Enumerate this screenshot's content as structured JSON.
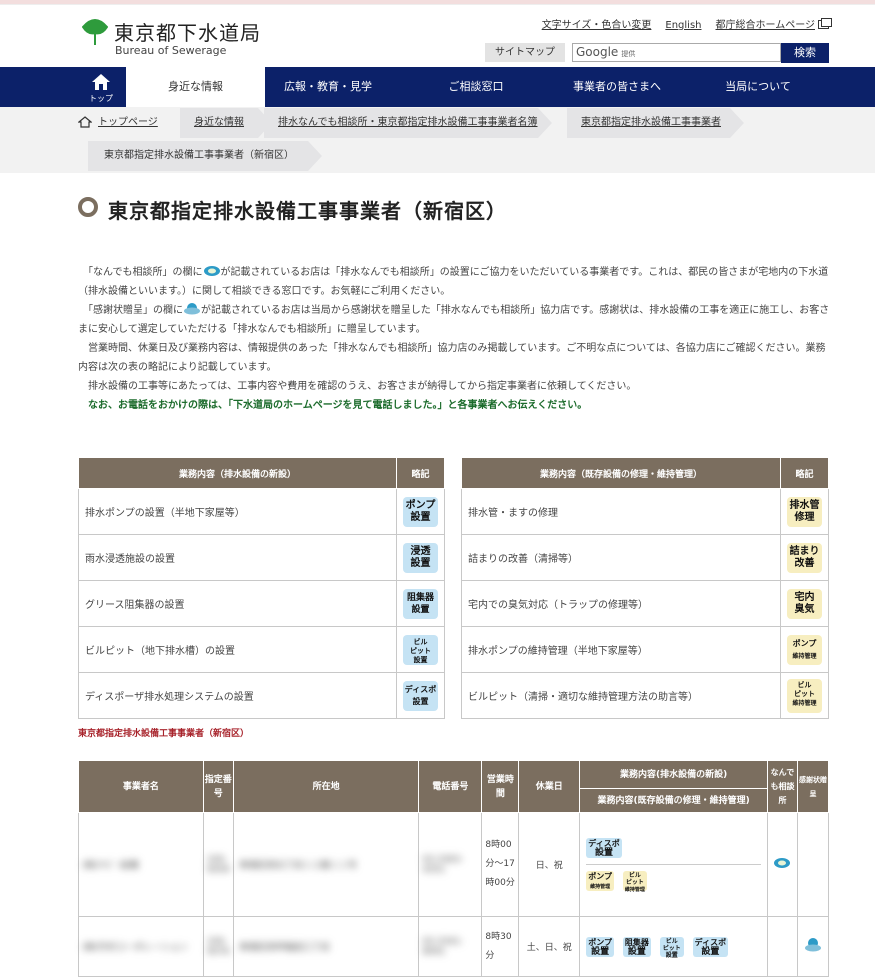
{
  "header": {
    "logo_title": "東京都下水道局",
    "logo_subtitle": "Bureau of Sewerage",
    "links": [
      "文字サイズ・色合い変更",
      "English",
      "都庁総合ホームページ"
    ],
    "sitemap": "サイトマップ",
    "search_google": "Google",
    "search_provided": "提供",
    "search_button": "検索"
  },
  "nav": {
    "home": "トップ",
    "items": [
      "身近な情報",
      "広報・教育・見学",
      "ご相談窓口",
      "事業者の皆さまへ",
      "当局について"
    ]
  },
  "breadcrumb": [
    "トップページ",
    "身近な情報",
    "排水なんでも相談所・東京都指定排水設備工事事業者名簿",
    "東京都指定排水設備工事事業者",
    "東京都指定排水設備工事事業者（新宿区）"
  ],
  "page_title": "東京都指定排水設備工事事業者（新宿区）",
  "intro": {
    "p1a": "「なんでも相談所」の欄に",
    "p1b": "が記載されているお店は「排水なんでも相談所」の設置にご協力をいただいている事業者です。これは、都民の皆さまが宅地内の下水道（排水設備といいます。）に関して相談できる窓口です。お気軽にご利用ください。",
    "p2a": "「感謝状贈呈」の欄に",
    "p2b": "が記載されているお店は当局から感謝状を贈呈した「排水なんでも相談所」協力店です。感謝状は、排水設備の工事を適正に施工し、お客さまに安心して選定していただける「排水なんでも相談所」に贈呈しています。",
    "p3": "営業時間、休業日及び業務内容は、情報提供のあった「排水なんでも相談所」協力店のみ掲載しています。ご不明な点については、各協力店にご確認ください。業務内容は次の表の略記により記載しています。",
    "p4": "排水設備の工事等にあたっては、工事内容や費用を確認のうえ、お客さまが納得してから指定事業者に依頼してください。",
    "note": "なお、お電話をおかけの際は、「下水道局のホームページを見て電話しました。」と各事業者へお伝えください。"
  },
  "new_table": {
    "h1": "業務内容（排水設備の新設）",
    "h2": "略記",
    "rows": [
      {
        "text": "排水ポンプの設置（半地下家屋等）",
        "badge": [
          "ポンプ",
          "設置"
        ]
      },
      {
        "text": "雨水浸透施設の設置",
        "badge": [
          "浸透",
          "設置"
        ]
      },
      {
        "text": "グリース阻集器の設置",
        "badge": [
          "阻集器",
          "設置"
        ]
      },
      {
        "text": "ビルピット（地下排水槽）の設置",
        "badge": [
          "ビル",
          "ピット",
          "設置"
        ]
      },
      {
        "text": "ディスポーザ排水処理システムの設置",
        "badge": [
          "ディスポ",
          "設置"
        ]
      }
    ]
  },
  "repair_table": {
    "h1": "業務内容（既存設備の修理・維持管理）",
    "h2": "略記",
    "rows": [
      {
        "text": "排水管・ますの修理",
        "badge": [
          "排水管",
          "修理"
        ]
      },
      {
        "text": "詰まりの改善（清掃等）",
        "badge": [
          "詰まり",
          "改善"
        ]
      },
      {
        "text": "宅内での臭気対応（トラップの修理等）",
        "badge": [
          "宅内",
          "臭気"
        ]
      },
      {
        "text": "排水ポンプの維持管理（半地下家屋等）",
        "badge": [
          "ポンプ",
          "維持管理"
        ]
      },
      {
        "text": "ビルピット（清掃・適切な維持管理方法の助言等）",
        "badge": [
          "ビル",
          "ピット",
          "維持管理"
        ]
      }
    ]
  },
  "section_title": "東京都指定排水設備工事事業者（新宿区）",
  "main_table": {
    "headers": {
      "name": "事業者名",
      "num": "指定番号",
      "addr": "所在地",
      "tel": "電話番号",
      "hours": "営業時間",
      "holiday": "休業日",
      "new": "業務内容(排水設備の新設)",
      "repair": "業務内容(既存設備の修理・維持管理)",
      "soudan": "なんでも相談所",
      "kansha": "感謝状贈呈"
    },
    "rows": [
      {
        "name": "(株)ｱｲﾋﾞｰ設備",
        "num": "100-0059",
        "addr": "新宿区西五丁目１２番１１号",
        "tel": "03-3363-4351",
        "hours": "8時00分～17時00分",
        "holiday": "日、祝",
        "new": [
          [
            "ディスポ",
            "設置"
          ]
        ],
        "repair": [
          [
            "ポンプ",
            "維持管理"
          ],
          [
            "ビル",
            "ピット",
            "維持管理"
          ]
        ]
      },
      {
        "name": "(株)竹村コーポレーション",
        "num": "100-0076",
        "addr": "新宿区西早稲田三丁目",
        "tel": "03-3341-8091",
        "hours": "8時30分",
        "holiday": "土、日、祝",
        "new": [
          [
            "ポンプ",
            "設置"
          ],
          [
            "阻集器",
            "設置"
          ],
          [
            "ビル",
            "ピット",
            "設置"
          ],
          [
            "ディスポ",
            "設置"
          ]
        ]
      }
    ]
  }
}
